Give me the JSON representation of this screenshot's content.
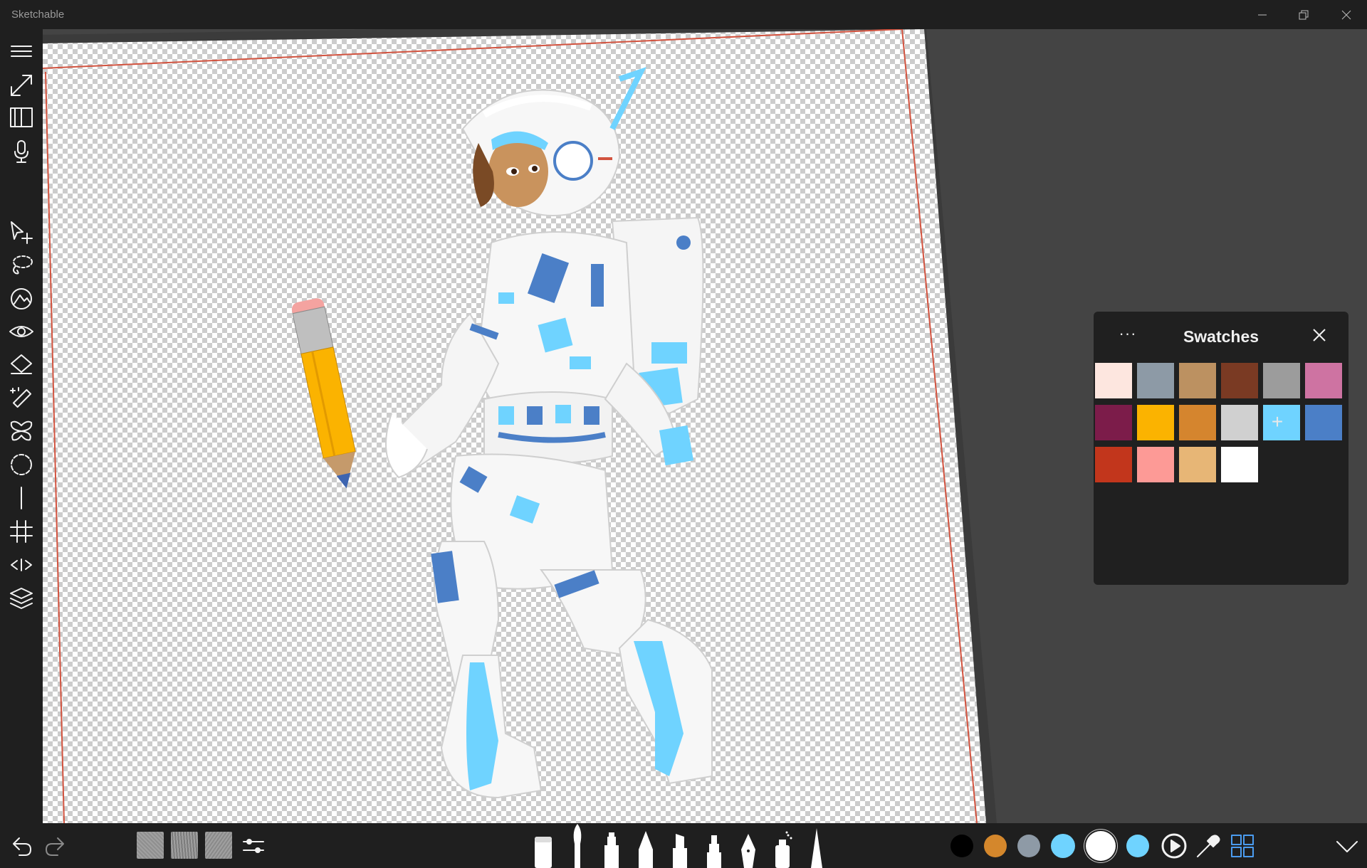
{
  "window": {
    "title": "Sketchable"
  },
  "sidebar": {
    "tools": [
      {
        "icon": "menu-icon"
      },
      {
        "icon": "fullscreen-icon"
      },
      {
        "icon": "journal-icon"
      },
      {
        "icon": "microphone-icon"
      },
      {
        "icon": "transform-select-icon"
      },
      {
        "icon": "lasso-select-icon"
      },
      {
        "icon": "fill-shape-icon"
      },
      {
        "icon": "eye-icon"
      },
      {
        "icon": "paint-bucket-icon"
      },
      {
        "icon": "magic-wand-icon"
      },
      {
        "icon": "symmetry-icon"
      },
      {
        "icon": "circle-guide-icon"
      },
      {
        "icon": "ruler-icon"
      },
      {
        "icon": "grid-icon"
      },
      {
        "icon": "perspective-icon"
      },
      {
        "icon": "layers-icon"
      }
    ]
  },
  "bottombar": {
    "textures": [
      "#8f8f8f",
      "#7c7c7c",
      "#8a8a8a"
    ],
    "brushes": [
      "eraser",
      "paintbrush",
      "marker",
      "pencil",
      "highlighter",
      "chalk",
      "fountain-pen",
      "spray-can",
      "fine-tip"
    ],
    "colors": [
      "#000000",
      "#d4872c",
      "#8e9aa6",
      "#6fd3ff",
      "#ffffff",
      "#6fd3ff"
    ]
  },
  "swatches_panel": {
    "title": "Swatches",
    "more_label": "···",
    "add_label": "+",
    "colors": [
      "#fde6df",
      "#8d9aa6",
      "#bc9161",
      "#7a3a23",
      "#9c9c9c",
      "#ce73a2",
      "#7c1c4a",
      "#fbb300",
      "#d5852e",
      "#d0d0d0",
      "#6fd3ff",
      "#4b7fc7",
      "#c2361c",
      "#fd9a96",
      "#e7b676",
      "#ffffff"
    ]
  }
}
